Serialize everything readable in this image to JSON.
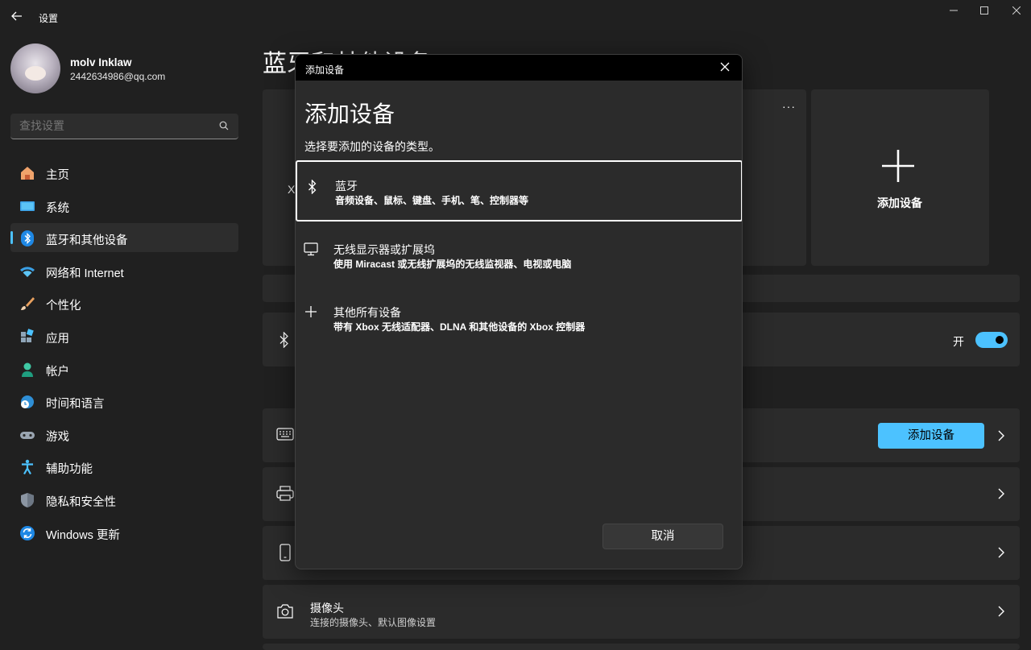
{
  "window": {
    "title": "设置",
    "back_icon": "back-arrow-icon"
  },
  "profile": {
    "name": "molv Inklaw",
    "email": "2442634986@qq.com"
  },
  "search": {
    "placeholder": "查找设置"
  },
  "sidebar": {
    "items": [
      {
        "label": "主页",
        "icon": "home-icon",
        "active": false
      },
      {
        "label": "系统",
        "icon": "system-icon",
        "active": false
      },
      {
        "label": "蓝牙和其他设备",
        "icon": "bluetooth-icon",
        "active": true
      },
      {
        "label": "网络和 Internet",
        "icon": "wifi-icon",
        "active": false
      },
      {
        "label": "个性化",
        "icon": "brush-icon",
        "active": false
      },
      {
        "label": "应用",
        "icon": "apps-icon",
        "active": false
      },
      {
        "label": "帐户",
        "icon": "account-icon",
        "active": false
      },
      {
        "label": "时间和语言",
        "icon": "clock-globe-icon",
        "active": false
      },
      {
        "label": "游戏",
        "icon": "gamepad-icon",
        "active": false
      },
      {
        "label": "辅助功能",
        "icon": "accessibility-icon",
        "active": false
      },
      {
        "label": "隐私和安全性",
        "icon": "shield-icon",
        "active": false
      },
      {
        "label": "Windows 更新",
        "icon": "update-icon",
        "active": false
      }
    ]
  },
  "main": {
    "heading": "蓝牙和其他设备",
    "partial_text": "X",
    "add_card_label": "添加设备",
    "bluetooth_toggle": {
      "label": "开",
      "on": true
    },
    "add_device_button": "添加设备",
    "camera_row": {
      "title": "摄像头",
      "subtitle": "连接的摄像头、默认图像设置"
    }
  },
  "dialog": {
    "titlebar": "添加设备",
    "heading": "添加设备",
    "subtitle": "选择要添加的设备的类型。",
    "options": [
      {
        "title": "蓝牙",
        "desc": "音频设备、鼠标、键盘、手机、笔、控制器等",
        "icon": "bluetooth-icon",
        "selected": true
      },
      {
        "title": "无线显示器或扩展坞",
        "desc": "使用 Miracast 或无线扩展坞的无线监视器、电视或电脑",
        "icon": "monitor-icon",
        "selected": false
      },
      {
        "title": "其他所有设备",
        "desc": "带有 Xbox 无线适配器、DLNA 和其他设备的 Xbox 控制器",
        "icon": "plus-icon",
        "selected": false
      }
    ],
    "cancel_label": "取消"
  },
  "colors": {
    "background": "#202020",
    "card": "#2b2b2b",
    "accent": "#4cc2ff",
    "dialog_titlebar": "#000000"
  }
}
